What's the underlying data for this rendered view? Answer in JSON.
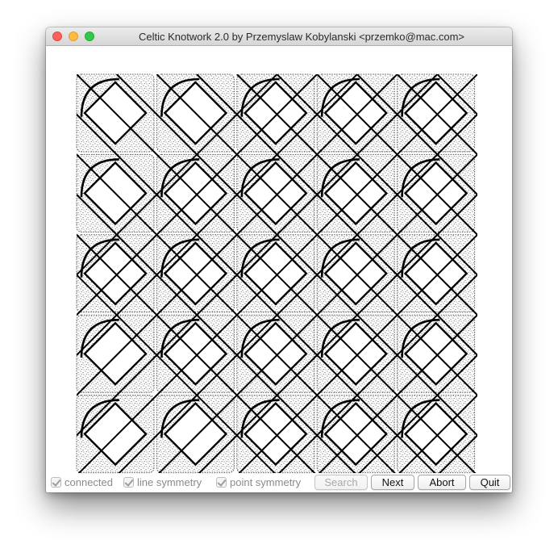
{
  "window": {
    "title": "Celtic Knotwork 2.0 by Przemyslaw Kobylanski <przemko@mac.com>"
  },
  "controls": {
    "connected_label": "connected",
    "line_symmetry_label": "line symmetry",
    "point_symmetry_label": "point symmetry",
    "search_label": "Search",
    "next_label": "Next",
    "abort_label": "Abort",
    "quit_label": "Quit"
  },
  "state": {
    "connected": true,
    "line_symmetry": true,
    "point_symmetry": true,
    "search_enabled": false
  },
  "knot": {
    "rows": 5,
    "cols": 5,
    "style": "stippled-interlace"
  },
  "colors": {
    "ink": "#000000",
    "stipple": "#444444"
  }
}
